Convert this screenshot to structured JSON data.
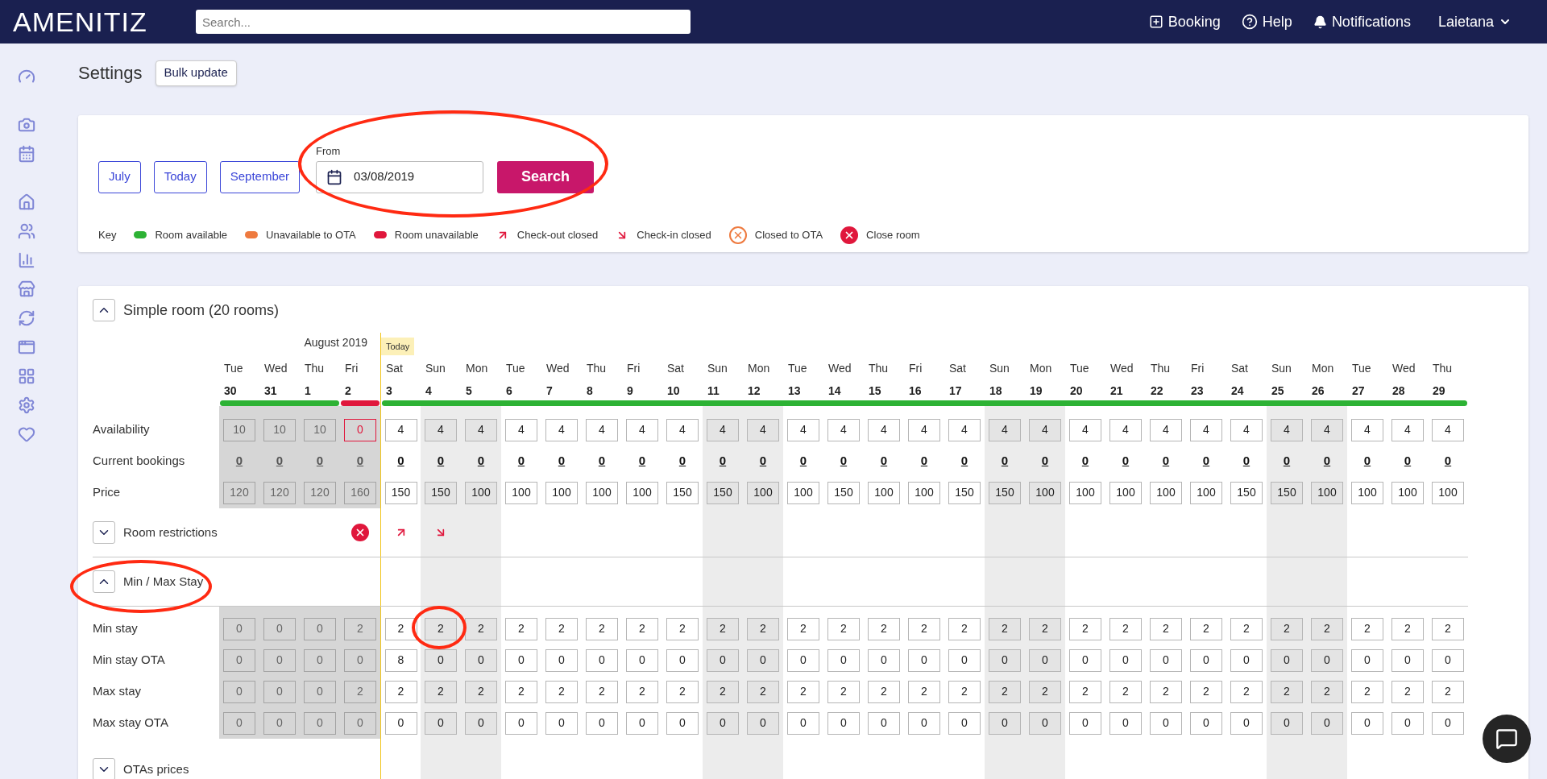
{
  "topbar": {
    "logo": "AMENITIZ",
    "search_placeholder": "Search...",
    "nav": [
      {
        "kind": "booking",
        "label": "Booking"
      },
      {
        "kind": "help",
        "label": "Help"
      },
      {
        "kind": "notifications",
        "label": "Notifications"
      }
    ],
    "user": "Laietana"
  },
  "page": {
    "title": "Settings",
    "bulk_button": "Bulk update"
  },
  "filter": {
    "buttons": [
      "July",
      "Today",
      "September"
    ],
    "date_label": "From",
    "date_value": "03/08/2019",
    "search_button": "Search",
    "key_label": "Key",
    "key": [
      {
        "kind": "dot",
        "label": "Room available",
        "color": "#2db234"
      },
      {
        "kind": "dot",
        "label": "Unavailable to OTA",
        "color": "#ee7a3f"
      },
      {
        "kind": "dot",
        "label": "Room unavailable",
        "color": "#e0173c"
      },
      {
        "kind": "checkout",
        "label": "Check-out closed"
      },
      {
        "kind": "checkin",
        "label": "Check-in closed"
      },
      {
        "kind": "closed_ota",
        "label": "Closed to OTA"
      },
      {
        "kind": "close_room",
        "label": "Close room"
      }
    ]
  },
  "room": {
    "title": "Simple room (20 rooms)",
    "expanded": true,
    "month": "August 2019",
    "today_label": "Today",
    "days": [
      {
        "weekday": "Tue",
        "date": "30",
        "past": true,
        "shaded": false,
        "today": false,
        "color": "#2db234",
        "closed": false,
        "checkout_closed": false,
        "checkin_closed": false
      },
      {
        "weekday": "Wed",
        "date": "31",
        "past": true,
        "shaded": false,
        "today": false,
        "color": "#2db234",
        "closed": false,
        "checkout_closed": false,
        "checkin_closed": false
      },
      {
        "weekday": "Thu",
        "date": "1",
        "past": true,
        "shaded": false,
        "today": false,
        "color": "#2db234",
        "closed": false,
        "checkout_closed": false,
        "checkin_closed": false
      },
      {
        "weekday": "Fri",
        "date": "2",
        "past": true,
        "shaded": false,
        "today": false,
        "color": "#e0173c",
        "closed": true,
        "checkout_closed": false,
        "checkin_closed": false
      },
      {
        "weekday": "Sat",
        "date": "3",
        "past": false,
        "shaded": false,
        "today": true,
        "color": "#2db234",
        "closed": false,
        "checkout_closed": true,
        "checkin_closed": false
      },
      {
        "weekday": "Sun",
        "date": "4",
        "past": false,
        "shaded": true,
        "today": false,
        "color": "#2db234",
        "closed": false,
        "checkout_closed": false,
        "checkin_closed": true
      },
      {
        "weekday": "Mon",
        "date": "5",
        "past": false,
        "shaded": true,
        "today": false,
        "color": "#2db234",
        "closed": false,
        "checkout_closed": false,
        "checkin_closed": false
      },
      {
        "weekday": "Tue",
        "date": "6",
        "past": false,
        "shaded": false,
        "today": false,
        "color": "#2db234",
        "closed": false,
        "checkout_closed": false,
        "checkin_closed": false
      },
      {
        "weekday": "Wed",
        "date": "7",
        "past": false,
        "shaded": false,
        "today": false,
        "color": "#2db234",
        "closed": false,
        "checkout_closed": false,
        "checkin_closed": false
      },
      {
        "weekday": "Thu",
        "date": "8",
        "past": false,
        "shaded": false,
        "today": false,
        "color": "#2db234",
        "closed": false,
        "checkout_closed": false,
        "checkin_closed": false
      },
      {
        "weekday": "Fri",
        "date": "9",
        "past": false,
        "shaded": false,
        "today": false,
        "color": "#2db234",
        "closed": false,
        "checkout_closed": false,
        "checkin_closed": false
      },
      {
        "weekday": "Sat",
        "date": "10",
        "past": false,
        "shaded": false,
        "today": false,
        "color": "#2db234",
        "closed": false,
        "checkout_closed": false,
        "checkin_closed": false
      },
      {
        "weekday": "Sun",
        "date": "11",
        "past": false,
        "shaded": true,
        "today": false,
        "color": "#2db234",
        "closed": false,
        "checkout_closed": false,
        "checkin_closed": false
      },
      {
        "weekday": "Mon",
        "date": "12",
        "past": false,
        "shaded": true,
        "today": false,
        "color": "#2db234",
        "closed": false,
        "checkout_closed": false,
        "checkin_closed": false
      },
      {
        "weekday": "Tue",
        "date": "13",
        "past": false,
        "shaded": false,
        "today": false,
        "color": "#2db234",
        "closed": false,
        "checkout_closed": false,
        "checkin_closed": false
      },
      {
        "weekday": "Wed",
        "date": "14",
        "past": false,
        "shaded": false,
        "today": false,
        "color": "#2db234",
        "closed": false,
        "checkout_closed": false,
        "checkin_closed": false
      },
      {
        "weekday": "Thu",
        "date": "15",
        "past": false,
        "shaded": false,
        "today": false,
        "color": "#2db234",
        "closed": false,
        "checkout_closed": false,
        "checkin_closed": false
      },
      {
        "weekday": "Fri",
        "date": "16",
        "past": false,
        "shaded": false,
        "today": false,
        "color": "#2db234",
        "closed": false,
        "checkout_closed": false,
        "checkin_closed": false
      },
      {
        "weekday": "Sat",
        "date": "17",
        "past": false,
        "shaded": false,
        "today": false,
        "color": "#2db234",
        "closed": false,
        "checkout_closed": false,
        "checkin_closed": false
      },
      {
        "weekday": "Sun",
        "date": "18",
        "past": false,
        "shaded": true,
        "today": false,
        "color": "#2db234",
        "closed": false,
        "checkout_closed": false,
        "checkin_closed": false
      },
      {
        "weekday": "Mon",
        "date": "19",
        "past": false,
        "shaded": true,
        "today": false,
        "color": "#2db234",
        "closed": false,
        "checkout_closed": false,
        "checkin_closed": false
      },
      {
        "weekday": "Tue",
        "date": "20",
        "past": false,
        "shaded": false,
        "today": false,
        "color": "#2db234",
        "closed": false,
        "checkout_closed": false,
        "checkin_closed": false
      },
      {
        "weekday": "Wed",
        "date": "21",
        "past": false,
        "shaded": false,
        "today": false,
        "color": "#2db234",
        "closed": false,
        "checkout_closed": false,
        "checkin_closed": false
      },
      {
        "weekday": "Thu",
        "date": "22",
        "past": false,
        "shaded": false,
        "today": false,
        "color": "#2db234",
        "closed": false,
        "checkout_closed": false,
        "checkin_closed": false
      },
      {
        "weekday": "Fri",
        "date": "23",
        "past": false,
        "shaded": false,
        "today": false,
        "color": "#2db234",
        "closed": false,
        "checkout_closed": false,
        "checkin_closed": false
      },
      {
        "weekday": "Sat",
        "date": "24",
        "past": false,
        "shaded": false,
        "today": false,
        "color": "#2db234",
        "closed": false,
        "checkout_closed": false,
        "checkin_closed": false
      },
      {
        "weekday": "Sun",
        "date": "25",
        "past": false,
        "shaded": true,
        "today": false,
        "color": "#2db234",
        "closed": false,
        "checkout_closed": false,
        "checkin_closed": false
      },
      {
        "weekday": "Mon",
        "date": "26",
        "past": false,
        "shaded": true,
        "today": false,
        "color": "#2db234",
        "closed": false,
        "checkout_closed": false,
        "checkin_closed": false
      },
      {
        "weekday": "Tue",
        "date": "27",
        "past": false,
        "shaded": false,
        "today": false,
        "color": "#2db234",
        "closed": false,
        "checkout_closed": false,
        "checkin_closed": false
      },
      {
        "weekday": "Wed",
        "date": "28",
        "past": false,
        "shaded": false,
        "today": false,
        "color": "#2db234",
        "closed": false,
        "checkout_closed": false,
        "checkin_closed": false
      },
      {
        "weekday": "Thu",
        "date": "29",
        "past": false,
        "shaded": false,
        "today": false,
        "color": "#2db234",
        "closed": false,
        "checkout_closed": false,
        "checkin_closed": false
      }
    ],
    "rows": [
      {
        "label": "Availability",
        "kind": "input",
        "values": [
          "10",
          "10",
          "10",
          "0",
          "4",
          "4",
          "4",
          "4",
          "4",
          "4",
          "4",
          "4",
          "4",
          "4",
          "4",
          "4",
          "4",
          "4",
          "4",
          "4",
          "4",
          "4",
          "4",
          "4",
          "4",
          "4",
          "4",
          "4",
          "4",
          "4",
          "4"
        ]
      },
      {
        "label": "Current bookings",
        "kind": "link",
        "values": [
          "0",
          "0",
          "0",
          "0",
          "0",
          "0",
          "0",
          "0",
          "0",
          "0",
          "0",
          "0",
          "0",
          "0",
          "0",
          "0",
          "0",
          "0",
          "0",
          "0",
          "0",
          "0",
          "0",
          "0",
          "0",
          "0",
          "0",
          "0",
          "0",
          "0",
          "0"
        ]
      },
      {
        "label": "Price",
        "kind": "input",
        "values": [
          "120",
          "120",
          "120",
          "160",
          "150",
          "150",
          "100",
          "100",
          "100",
          "100",
          "100",
          "150",
          "150",
          "100",
          "100",
          "150",
          "100",
          "100",
          "150",
          "150",
          "100",
          "100",
          "100",
          "100",
          "100",
          "150",
          "150",
          "100",
          "100",
          "100",
          "100"
        ]
      }
    ],
    "sections": [
      {
        "title": "Room restrictions",
        "expanded": false,
        "kind": "restrictions"
      },
      {
        "title": "Min / Max Stay",
        "expanded": true,
        "kind": "rows",
        "rows": [
          {
            "label": "Min stay",
            "kind": "input",
            "values": [
              "0",
              "0",
              "0",
              "2",
              "2",
              "2",
              "2",
              "2",
              "2",
              "2",
              "2",
              "2",
              "2",
              "2",
              "2",
              "2",
              "2",
              "2",
              "2",
              "2",
              "2",
              "2",
              "2",
              "2",
              "2",
              "2",
              "2",
              "2",
              "2",
              "2",
              "2"
            ]
          },
          {
            "label": "Min stay OTA",
            "kind": "input",
            "values": [
              "0",
              "0",
              "0",
              "0",
              "8",
              "0",
              "0",
              "0",
              "0",
              "0",
              "0",
              "0",
              "0",
              "0",
              "0",
              "0",
              "0",
              "0",
              "0",
              "0",
              "0",
              "0",
              "0",
              "0",
              "0",
              "0",
              "0",
              "0",
              "0",
              "0",
              "0"
            ]
          },
          {
            "label": "Max stay",
            "kind": "input",
            "values": [
              "0",
              "0",
              "0",
              "2",
              "2",
              "2",
              "2",
              "2",
              "2",
              "2",
              "2",
              "2",
              "2",
              "2",
              "2",
              "2",
              "2",
              "2",
              "2",
              "2",
              "2",
              "2",
              "2",
              "2",
              "2",
              "2",
              "2",
              "2",
              "2",
              "2",
              "2"
            ]
          },
          {
            "label": "Max stay OTA",
            "kind": "input",
            "values": [
              "0",
              "0",
              "0",
              "0",
              "0",
              "0",
              "0",
              "0",
              "0",
              "0",
              "0",
              "0",
              "0",
              "0",
              "0",
              "0",
              "0",
              "0",
              "0",
              "0",
              "0",
              "0",
              "0",
              "0",
              "0",
              "0",
              "0",
              "0",
              "0",
              "0",
              "0"
            ]
          }
        ]
      },
      {
        "title": "OTAs prices",
        "expanded": false,
        "kind": "rows"
      }
    ]
  }
}
